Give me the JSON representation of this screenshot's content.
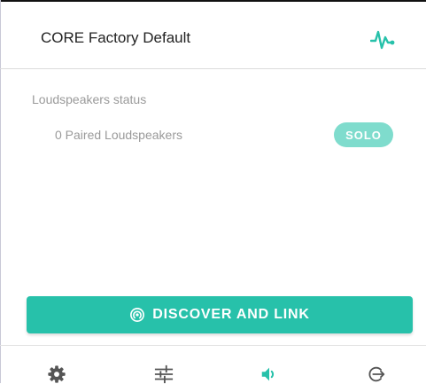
{
  "header": {
    "title": "CORE Factory Default",
    "status_icon": "activity-icon"
  },
  "status": {
    "section_label": "Loudspeakers status",
    "paired_text": "0 Paired Loudspeakers",
    "solo_label": "SOLO"
  },
  "actions": {
    "discover_label": "DISCOVER AND LINK",
    "discover_icon": "broadcast-icon"
  },
  "bottom_nav": {
    "items": [
      {
        "icon": "settings-icon",
        "active": false
      },
      {
        "icon": "mixer-sliders-icon",
        "active": false
      },
      {
        "icon": "speaker-icon",
        "active": true
      },
      {
        "icon": "exit-icon",
        "active": false
      }
    ]
  },
  "colors": {
    "accent": "#27c1aa",
    "accent_light": "#7fdccd",
    "icon_inactive": "#555555",
    "muted_text": "#9a9a9a"
  }
}
